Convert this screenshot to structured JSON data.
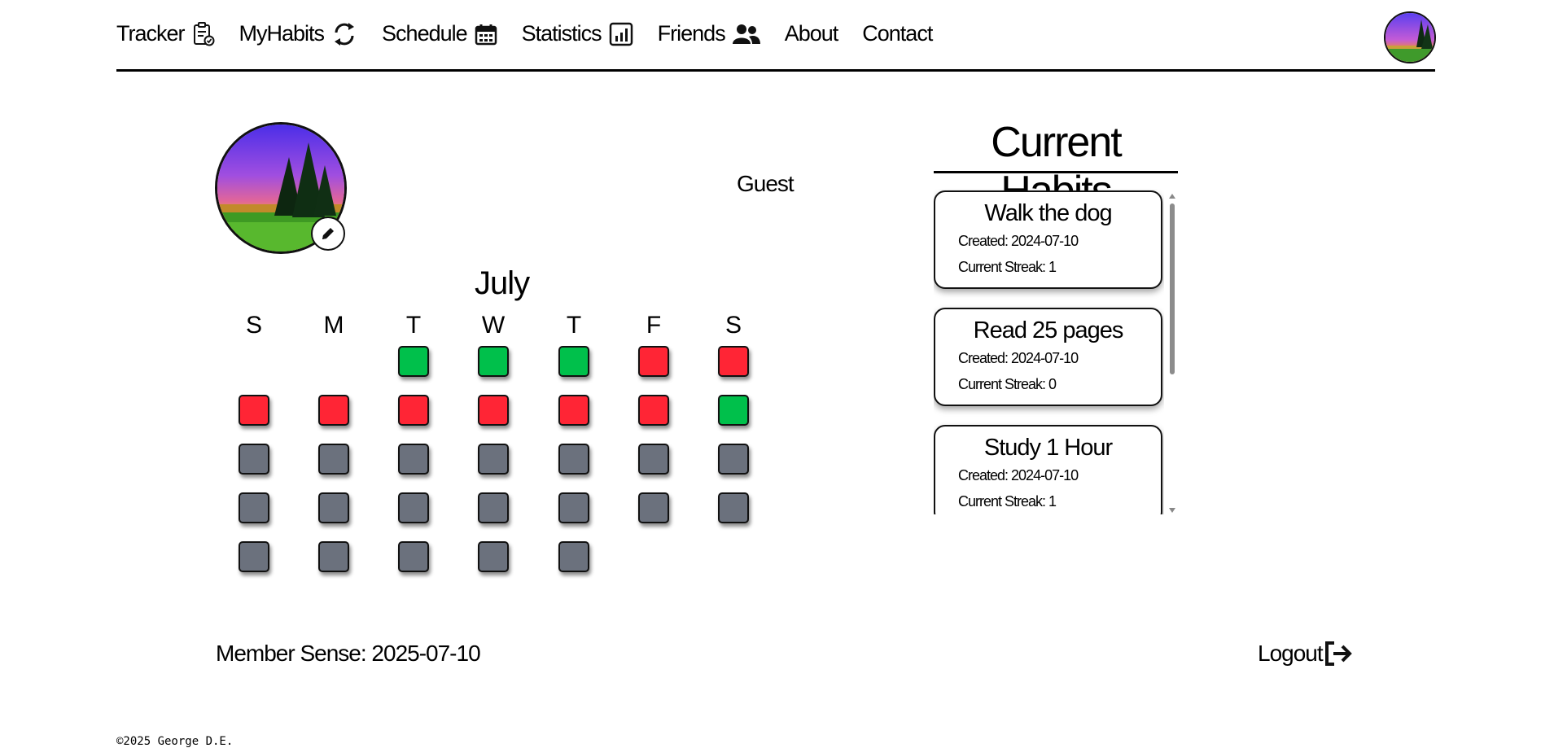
{
  "nav": {
    "items": [
      {
        "label": "Tracker",
        "icon": "clipboard-check-icon"
      },
      {
        "label": "MyHabits",
        "icon": "refresh-icon"
      },
      {
        "label": "Schedule",
        "icon": "calendar-icon"
      },
      {
        "label": "Statistics",
        "icon": "bar-chart-icon"
      },
      {
        "label": "Friends",
        "icon": "users-icon"
      },
      {
        "label": "About",
        "icon": ""
      },
      {
        "label": "Contact",
        "icon": ""
      }
    ]
  },
  "profile": {
    "username": "Guest",
    "member_since": "Member Sense: 2025-07-10",
    "logout_label": "Logout"
  },
  "calendar": {
    "month": "July",
    "day_headers": [
      "S",
      "M",
      "T",
      "W",
      "T",
      "F",
      "S"
    ],
    "first_weekday_index": 2,
    "days": [
      "done",
      "done",
      "done",
      "missed",
      "missed",
      "missed",
      "missed",
      "missed",
      "missed",
      "missed",
      "missed",
      "done",
      "future",
      "future",
      "future",
      "future",
      "future",
      "future",
      "future",
      "future",
      "future",
      "future",
      "future",
      "future",
      "future",
      "future",
      "future",
      "future",
      "future",
      "future",
      "future"
    ],
    "status_colors": {
      "done": "#00c04b",
      "missed": "#ff2535",
      "future": "#6b717d"
    }
  },
  "habits": {
    "title": "Current Habits",
    "items": [
      {
        "name": "Walk the dog",
        "created": "Created: 2024-07-10",
        "streak": "Current Streak: 1"
      },
      {
        "name": "Read 25 pages",
        "created": "Created: 2024-07-10",
        "streak": "Current Streak: 0"
      },
      {
        "name": "Study 1 Hour",
        "created": "Created: 2024-07-10",
        "streak": "Current Streak: 1"
      }
    ]
  },
  "footer": {
    "text": "©2025 George D.E."
  }
}
